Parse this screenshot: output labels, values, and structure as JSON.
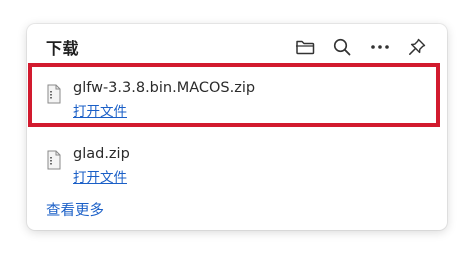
{
  "panel": {
    "title": "下载"
  },
  "toolbar": {
    "icons": [
      "folder-icon",
      "search-icon",
      "more-icon",
      "pin-icon"
    ]
  },
  "downloads": [
    {
      "file_name": "glfw-3.3.8.bin.MACOS.zip",
      "action_label": "打开文件"
    },
    {
      "file_name": "glad.zip",
      "action_label": "打开文件"
    }
  ],
  "footer": {
    "see_more_label": "查看更多"
  },
  "colors": {
    "link": "#1a5fc7",
    "highlight": "#d21a2e"
  }
}
